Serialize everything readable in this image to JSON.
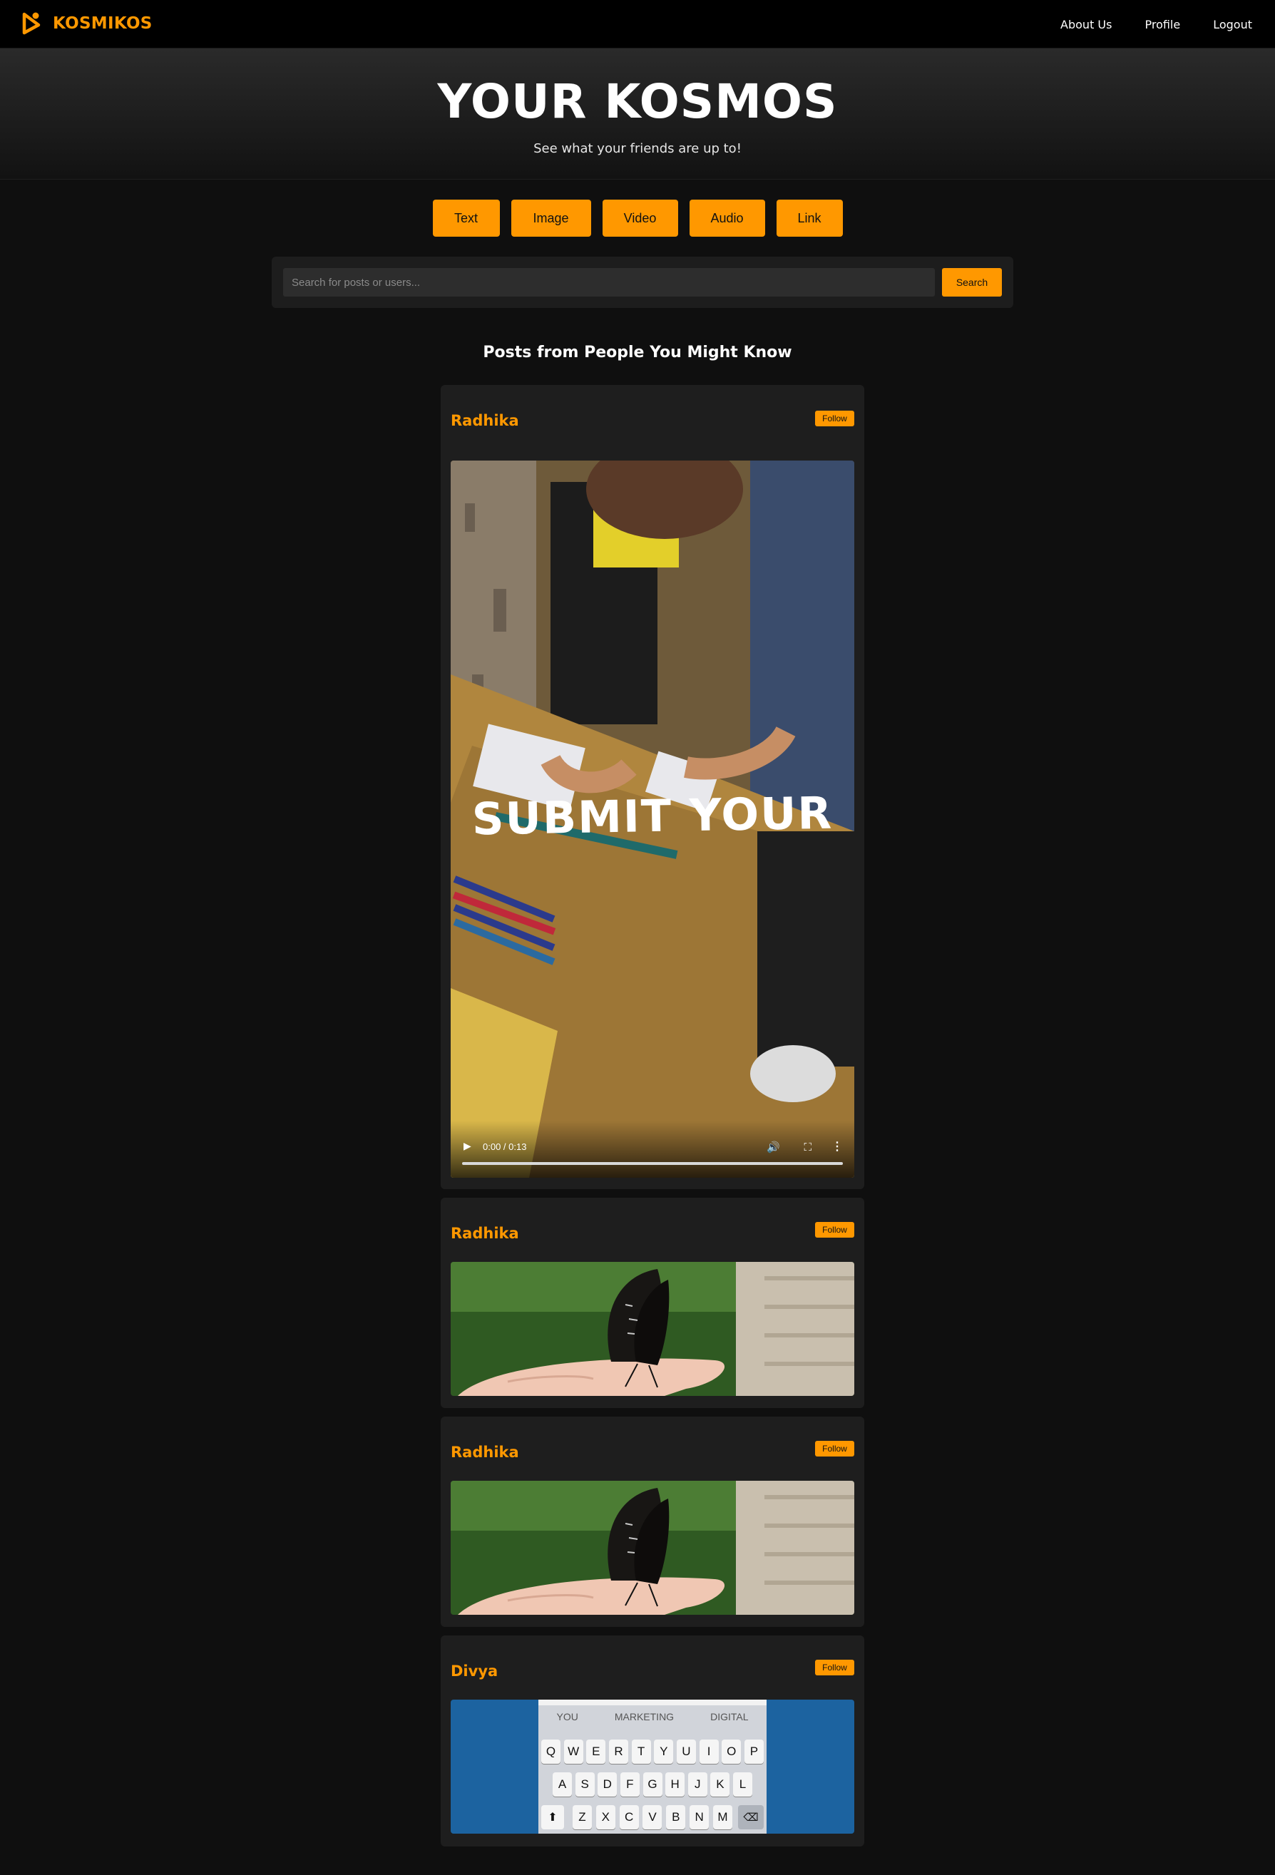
{
  "nav": {
    "brand": "KOSMIKOS",
    "links": [
      "About Us",
      "Profile",
      "Logout"
    ]
  },
  "hero": {
    "title": "YOUR KOSMOS",
    "subtitle": "See what your friends are up to!"
  },
  "post_types": [
    "Text",
    "Image",
    "Video",
    "Audio",
    "Link"
  ],
  "search": {
    "placeholder": "Search for posts or users...",
    "button": "Search"
  },
  "section_title": "Posts from People You Might Know",
  "posts": [
    {
      "author": "Radhika",
      "follow": "Follow",
      "media_type": "video",
      "overlay_text": "SUBMIT YOUR",
      "time": "0:00 / 0:13",
      "progress": 0
    },
    {
      "author": "Radhika",
      "follow": "Follow",
      "media_type": "image"
    },
    {
      "author": "Radhika",
      "follow": "Follow",
      "media_type": "image"
    },
    {
      "author": "Divya",
      "follow": "Follow",
      "media_type": "image",
      "keyboard": {
        "suggestions": [
          "YOU",
          "MARKETING",
          "DIGITAL"
        ],
        "row1": [
          "Q",
          "W",
          "E",
          "R",
          "T",
          "Y",
          "U",
          "I",
          "O",
          "P"
        ],
        "row2": [
          "A",
          "S",
          "D",
          "F",
          "G",
          "H",
          "J",
          "K",
          "L"
        ],
        "row3": [
          "Z",
          "X",
          "C",
          "V",
          "B",
          "N",
          "M"
        ]
      }
    }
  ],
  "colors": {
    "accent": "#ff9800",
    "background": "#0f0f0f",
    "card": "#1e1e1e",
    "navbar": "#000000"
  }
}
